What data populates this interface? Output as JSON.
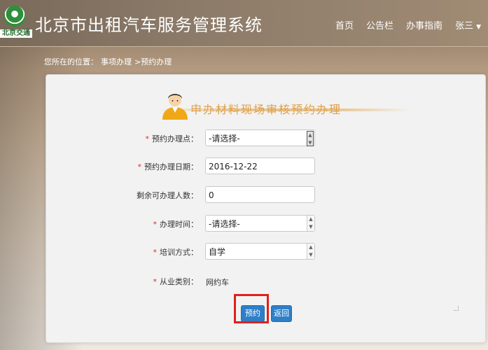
{
  "header": {
    "logo_text": "北京交通",
    "title": "北京市出租汽车服务管理系统",
    "nav": [
      {
        "label": "首页"
      },
      {
        "label": "公告栏"
      },
      {
        "label": "办事指南"
      },
      {
        "label": "张三"
      }
    ]
  },
  "breadcrumb": {
    "prefix": "您所在的位置：",
    "item1": "事项办理",
    "item2": ">预约办理"
  },
  "panel": {
    "heading": "申办材料现场审核预约办理",
    "fields": {
      "location": {
        "label": "预约办理点：",
        "value": "-请选择-",
        "required": true
      },
      "date": {
        "label": "预约办理日期：",
        "value": "2016-12-22",
        "required": true
      },
      "remaining": {
        "label": "剩余可办理人数：",
        "value": "0",
        "required": false
      },
      "time": {
        "label": "办理时间：",
        "value": "-请选择-",
        "required": true
      },
      "training": {
        "label": "培训方式：",
        "value": "自学",
        "required": true
      },
      "category": {
        "label": "从业类别：",
        "value": "网约车",
        "required": true
      }
    },
    "required_mark": "*",
    "buttons": {
      "submit": "预约",
      "back": "返回"
    }
  },
  "colors": {
    "accent": "#2e7fc8",
    "highlight": "#e0201c",
    "heading": "#e0a04a"
  }
}
